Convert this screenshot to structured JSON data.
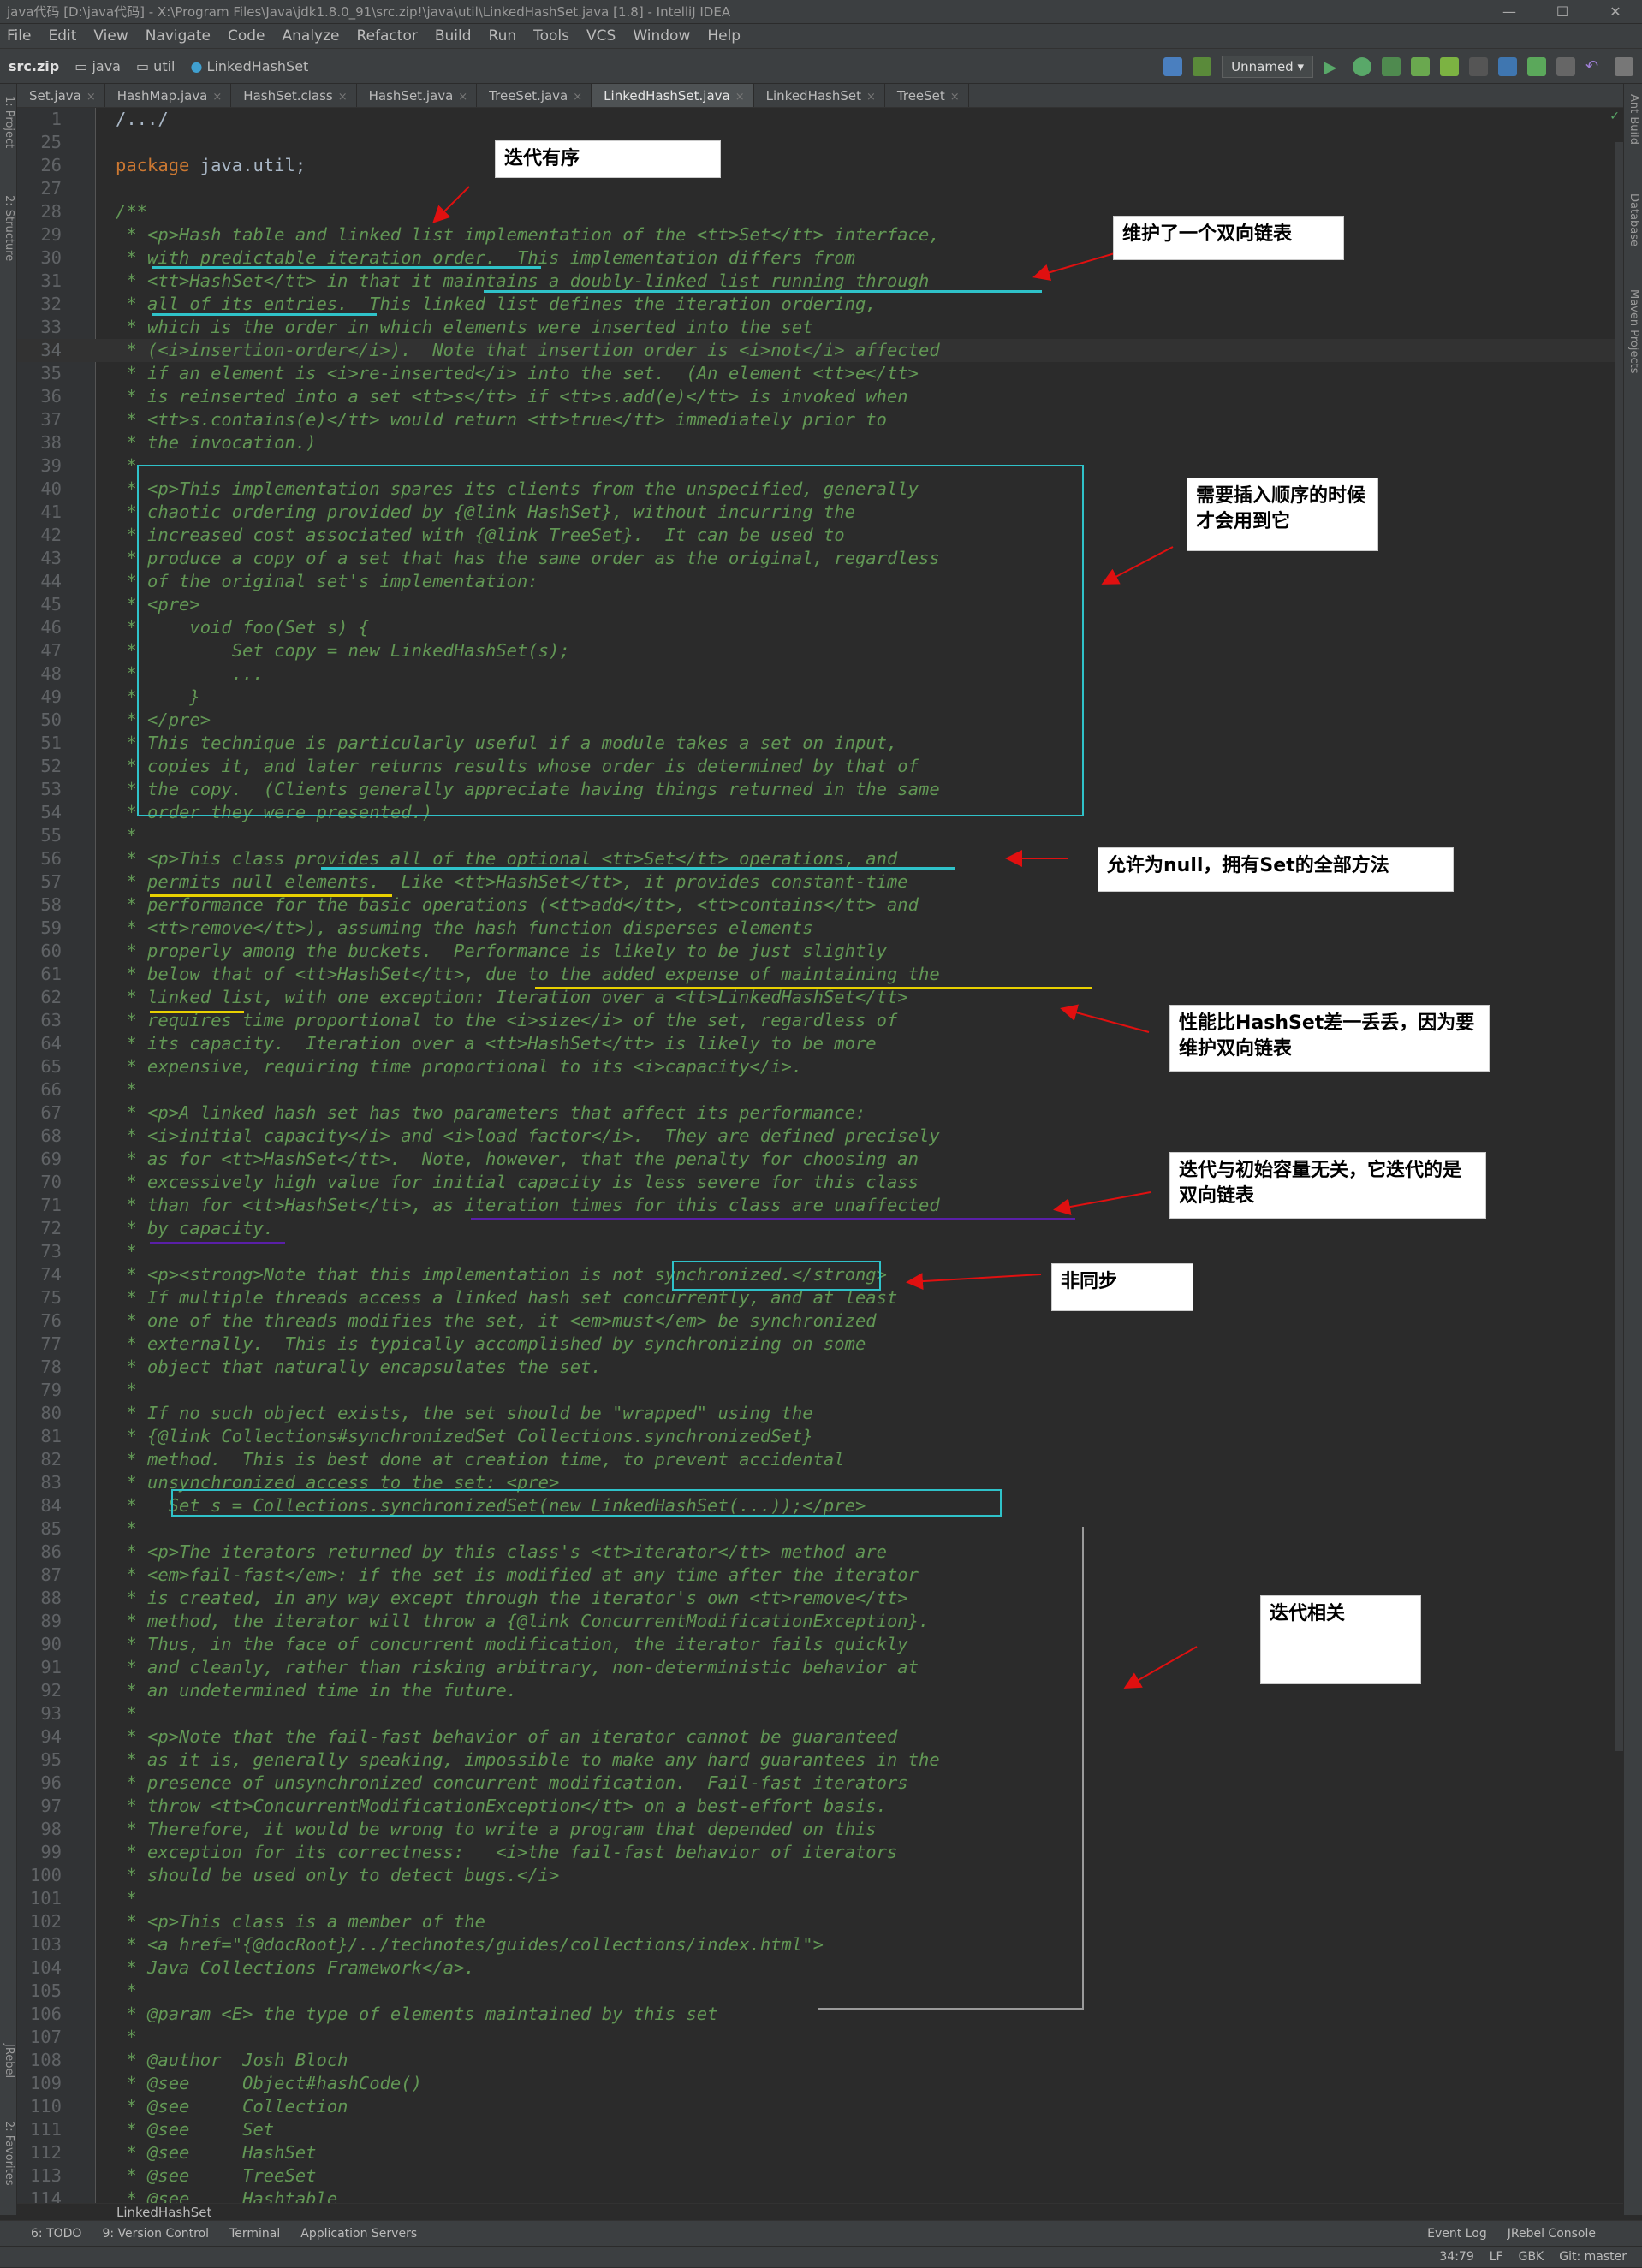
{
  "window": {
    "title": "java代码 [D:\\java代码] - X:\\Program Files\\Java\\jdk1.8.0_91\\src.zip!\\java\\util\\LinkedHashSet.java [1.8] - IntelliJ IDEA",
    "minimize": "—",
    "maximize": "☐",
    "close": "✕"
  },
  "menu": [
    "File",
    "Edit",
    "View",
    "Navigate",
    "Code",
    "Analyze",
    "Refactor",
    "Build",
    "Run",
    "Tools",
    "VCS",
    "Window",
    "Help"
  ],
  "breadcrumbs": [
    "src.zip",
    "java",
    "util",
    "LinkedHashSet"
  ],
  "run_config": "Unnamed ▾",
  "tabs": [
    {
      "label": "Set.java",
      "active": false
    },
    {
      "label": "HashMap.java",
      "active": false
    },
    {
      "label": "HashSet.class",
      "active": false
    },
    {
      "label": "HashSet.java",
      "active": false
    },
    {
      "label": "TreeSet.java",
      "active": false
    },
    {
      "label": "LinkedHashSet.java",
      "active": true
    },
    {
      "label": "LinkedHashSet",
      "active": false
    },
    {
      "label": "TreeSet",
      "active": false
    }
  ],
  "left_tools": [
    "1: Project",
    "2: Structure",
    "JRebel",
    "2: Favorites"
  ],
  "right_tools": [
    "Ant Build",
    "Database",
    "Maven Projects"
  ],
  "code_lines": [
    {
      "n": "1",
      "t": "/.../"
    },
    {
      "n": "25",
      "t": ""
    },
    {
      "n": "26",
      "t": "package java.util;"
    },
    {
      "n": "27",
      "t": ""
    },
    {
      "n": "28",
      "t": "/**"
    },
    {
      "n": "29",
      "t": " * <p>Hash table and linked list implementation of the <tt>Set</tt> interface,"
    },
    {
      "n": "30",
      "t": " * with predictable iteration order.  This implementation differs from"
    },
    {
      "n": "31",
      "t": " * <tt>HashSet</tt> in that it maintains a doubly-linked list running through"
    },
    {
      "n": "32",
      "t": " * all of its entries.  This linked list defines the iteration ordering,"
    },
    {
      "n": "33",
      "t": " * which is the order in which elements were inserted into the set"
    },
    {
      "n": "34",
      "t": " * (<i>insertion-order</i>).  Note that insertion order is <i>not</i> affected"
    },
    {
      "n": "35",
      "t": " * if an element is <i>re-inserted</i> into the set.  (An element <tt>e</tt>"
    },
    {
      "n": "36",
      "t": " * is reinserted into a set <tt>s</tt> if <tt>s.add(e)</tt> is invoked when"
    },
    {
      "n": "37",
      "t": " * <tt>s.contains(e)</tt> would return <tt>true</tt> immediately prior to"
    },
    {
      "n": "38",
      "t": " * the invocation.)"
    },
    {
      "n": "39",
      "t": " *"
    },
    {
      "n": "40",
      "t": " * <p>This implementation spares its clients from the unspecified, generally"
    },
    {
      "n": "41",
      "t": " * chaotic ordering provided by {@link HashSet}, without incurring the"
    },
    {
      "n": "42",
      "t": " * increased cost associated with {@link TreeSet}.  It can be used to"
    },
    {
      "n": "43",
      "t": " * produce a copy of a set that has the same order as the original, regardless"
    },
    {
      "n": "44",
      "t": " * of the original set's implementation:"
    },
    {
      "n": "45",
      "t": " * <pre>"
    },
    {
      "n": "46",
      "t": " *     void foo(Set s) {"
    },
    {
      "n": "47",
      "t": " *         Set copy = new LinkedHashSet(s);"
    },
    {
      "n": "48",
      "t": " *         ..."
    },
    {
      "n": "49",
      "t": " *     }"
    },
    {
      "n": "50",
      "t": " * </pre>"
    },
    {
      "n": "51",
      "t": " * This technique is particularly useful if a module takes a set on input,"
    },
    {
      "n": "52",
      "t": " * copies it, and later returns results whose order is determined by that of"
    },
    {
      "n": "53",
      "t": " * the copy.  (Clients generally appreciate having things returned in the same"
    },
    {
      "n": "54",
      "t": " * order they were presented.)"
    },
    {
      "n": "55",
      "t": " *"
    },
    {
      "n": "56",
      "t": " * <p>This class provides all of the optional <tt>Set</tt> operations, and"
    },
    {
      "n": "57",
      "t": " * permits null elements.  Like <tt>HashSet</tt>, it provides constant-time"
    },
    {
      "n": "58",
      "t": " * performance for the basic operations (<tt>add</tt>, <tt>contains</tt> and"
    },
    {
      "n": "59",
      "t": " * <tt>remove</tt>), assuming the hash function disperses elements"
    },
    {
      "n": "60",
      "t": " * properly among the buckets.  Performance is likely to be just slightly"
    },
    {
      "n": "61",
      "t": " * below that of <tt>HashSet</tt>, due to the added expense of maintaining the"
    },
    {
      "n": "62",
      "t": " * linked list, with one exception: Iteration over a <tt>LinkedHashSet</tt>"
    },
    {
      "n": "63",
      "t": " * requires time proportional to the <i>size</i> of the set, regardless of"
    },
    {
      "n": "64",
      "t": " * its capacity.  Iteration over a <tt>HashSet</tt> is likely to be more"
    },
    {
      "n": "65",
      "t": " * expensive, requiring time proportional to its <i>capacity</i>."
    },
    {
      "n": "66",
      "t": " *"
    },
    {
      "n": "67",
      "t": " * <p>A linked hash set has two parameters that affect its performance:"
    },
    {
      "n": "68",
      "t": " * <i>initial capacity</i> and <i>load factor</i>.  They are defined precisely"
    },
    {
      "n": "69",
      "t": " * as for <tt>HashSet</tt>.  Note, however, that the penalty for choosing an"
    },
    {
      "n": "70",
      "t": " * excessively high value for initial capacity is less severe for this class"
    },
    {
      "n": "71",
      "t": " * than for <tt>HashSet</tt>, as iteration times for this class are unaffected"
    },
    {
      "n": "72",
      "t": " * by capacity."
    },
    {
      "n": "73",
      "t": " *"
    },
    {
      "n": "74",
      "t": " * <p><strong>Note that this implementation is not synchronized.</strong>"
    },
    {
      "n": "75",
      "t": " * If multiple threads access a linked hash set concurrently, and at least"
    },
    {
      "n": "76",
      "t": " * one of the threads modifies the set, it <em>must</em> be synchronized"
    },
    {
      "n": "77",
      "t": " * externally.  This is typically accomplished by synchronizing on some"
    },
    {
      "n": "78",
      "t": " * object that naturally encapsulates the set."
    },
    {
      "n": "79",
      "t": " *"
    },
    {
      "n": "80",
      "t": " * If no such object exists, the set should be \"wrapped\" using the"
    },
    {
      "n": "81",
      "t": " * {@link Collections#synchronizedSet Collections.synchronizedSet}"
    },
    {
      "n": "82",
      "t": " * method.  This is best done at creation time, to prevent accidental"
    },
    {
      "n": "83",
      "t": " * unsynchronized access to the set: <pre>"
    },
    {
      "n": "84",
      "t": " *   Set s = Collections.synchronizedSet(new LinkedHashSet(...));</pre>"
    },
    {
      "n": "85",
      "t": " *"
    },
    {
      "n": "86",
      "t": " * <p>The iterators returned by this class's <tt>iterator</tt> method are"
    },
    {
      "n": "87",
      "t": " * <em>fail-fast</em>: if the set is modified at any time after the iterator"
    },
    {
      "n": "88",
      "t": " * is created, in any way except through the iterator's own <tt>remove</tt>"
    },
    {
      "n": "89",
      "t": " * method, the iterator will throw a {@link ConcurrentModificationException}."
    },
    {
      "n": "90",
      "t": " * Thus, in the face of concurrent modification, the iterator fails quickly"
    },
    {
      "n": "91",
      "t": " * and cleanly, rather than risking arbitrary, non-deterministic behavior at"
    },
    {
      "n": "92",
      "t": " * an undetermined time in the future."
    },
    {
      "n": "93",
      "t": " *"
    },
    {
      "n": "94",
      "t": " * <p>Note that the fail-fast behavior of an iterator cannot be guaranteed"
    },
    {
      "n": "95",
      "t": " * as it is, generally speaking, impossible to make any hard guarantees in the"
    },
    {
      "n": "96",
      "t": " * presence of unsynchronized concurrent modification.  Fail-fast iterators"
    },
    {
      "n": "97",
      "t": " * throw <tt>ConcurrentModificationException</tt> on a best-effort basis."
    },
    {
      "n": "98",
      "t": " * Therefore, it would be wrong to write a program that depended on this"
    },
    {
      "n": "99",
      "t": " * exception for its correctness:   <i>the fail-fast behavior of iterators"
    },
    {
      "n": "100",
      "t": " * should be used only to detect bugs.</i>"
    },
    {
      "n": "101",
      "t": " *"
    },
    {
      "n": "102",
      "t": " * <p>This class is a member of the"
    },
    {
      "n": "103",
      "t": " * <a href=\"{@docRoot}/../technotes/guides/collections/index.html\">"
    },
    {
      "n": "104",
      "t": " * Java Collections Framework</a>."
    },
    {
      "n": "105",
      "t": " *"
    },
    {
      "n": "106",
      "t": " * @param <E> the type of elements maintained by this set"
    },
    {
      "n": "107",
      "t": " *"
    },
    {
      "n": "108",
      "t": " * @author  Josh Bloch"
    },
    {
      "n": "109",
      "t": " * @see     Object#hashCode()"
    },
    {
      "n": "110",
      "t": " * @see     Collection"
    },
    {
      "n": "111",
      "t": " * @see     Set"
    },
    {
      "n": "112",
      "t": " * @see     HashSet"
    },
    {
      "n": "113",
      "t": " * @see     TreeSet"
    },
    {
      "n": "114",
      "t": " * @see     Hashtable"
    }
  ],
  "notes": [
    "迭代有序",
    "维护了一个双向链表",
    "需要插入顺序的时候才会用到它",
    "允许为null，拥有Set的全部方法",
    "性能比HashSet差一丢丢，因为要维护双向链表",
    "迭代与初始容量无关，它迭代的是双向链表",
    "非同步",
    "迭代相关"
  ],
  "bottom_breadcrumb": "LinkedHashSet",
  "tool_windows_left": [
    "6: TODO",
    "9: Version Control",
    "Terminal",
    "Application Servers"
  ],
  "tool_windows_right": [
    "Event Log",
    "JRebel Console"
  ],
  "status": {
    "position": "34:79",
    "line_sep": "LF",
    "encoding": "GBK",
    "vcs": "Git: master"
  },
  "colors": {
    "comment": "#629755",
    "keyword": "#cc7832",
    "annotation_box": "#2fc2c9",
    "arrow": "#e01010",
    "underline_cyan": "#2fc2c9",
    "underline_yellow": "#e8d000",
    "underline_purple": "#5a1fa8"
  }
}
